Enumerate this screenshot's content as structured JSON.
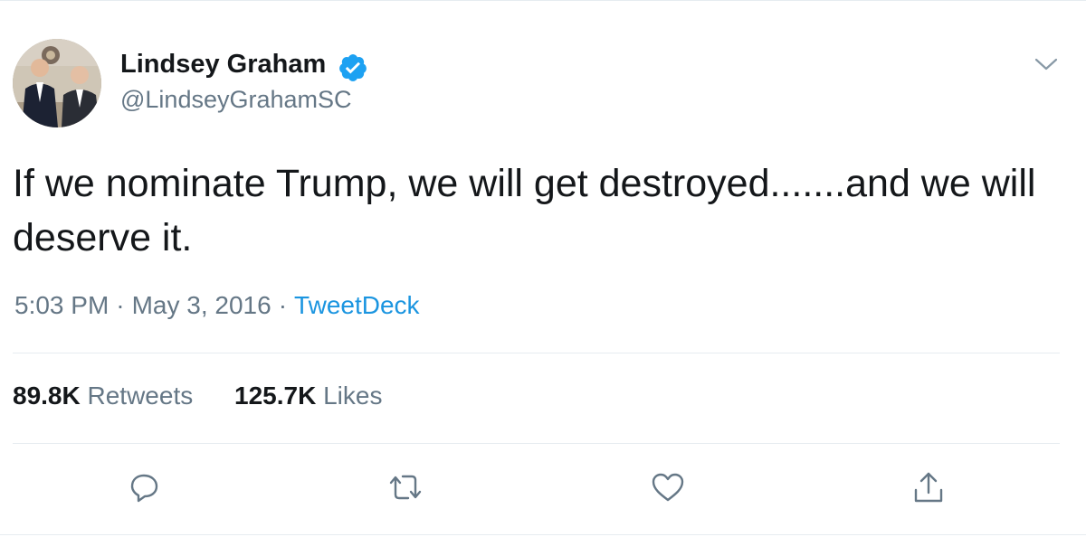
{
  "author": {
    "display_name": "Lindsey Graham",
    "handle": "@LindseyGrahamSC",
    "avatar_icon": "profile-photo",
    "verified_icon": "verified-badge-icon"
  },
  "tweet": {
    "text": "If we nominate Trump, we will get destroyed.......and we will deserve it.",
    "time": "5:03 PM",
    "separator": "·",
    "date": "May 3, 2016",
    "source": "TweetDeck"
  },
  "stats": {
    "retweets_count": "89.8K",
    "retweets_label": "Retweets",
    "likes_count": "125.7K",
    "likes_label": "Likes"
  },
  "actions": {
    "reply_icon": "reply-icon",
    "retweet_icon": "retweet-icon",
    "like_icon": "heart-icon",
    "share_icon": "share-icon"
  },
  "colors": {
    "link": "#1b95e0",
    "secondary_text": "#657786",
    "primary_text": "#14171a",
    "verified": "#1da1f2",
    "divider": "#e6ecf0"
  }
}
